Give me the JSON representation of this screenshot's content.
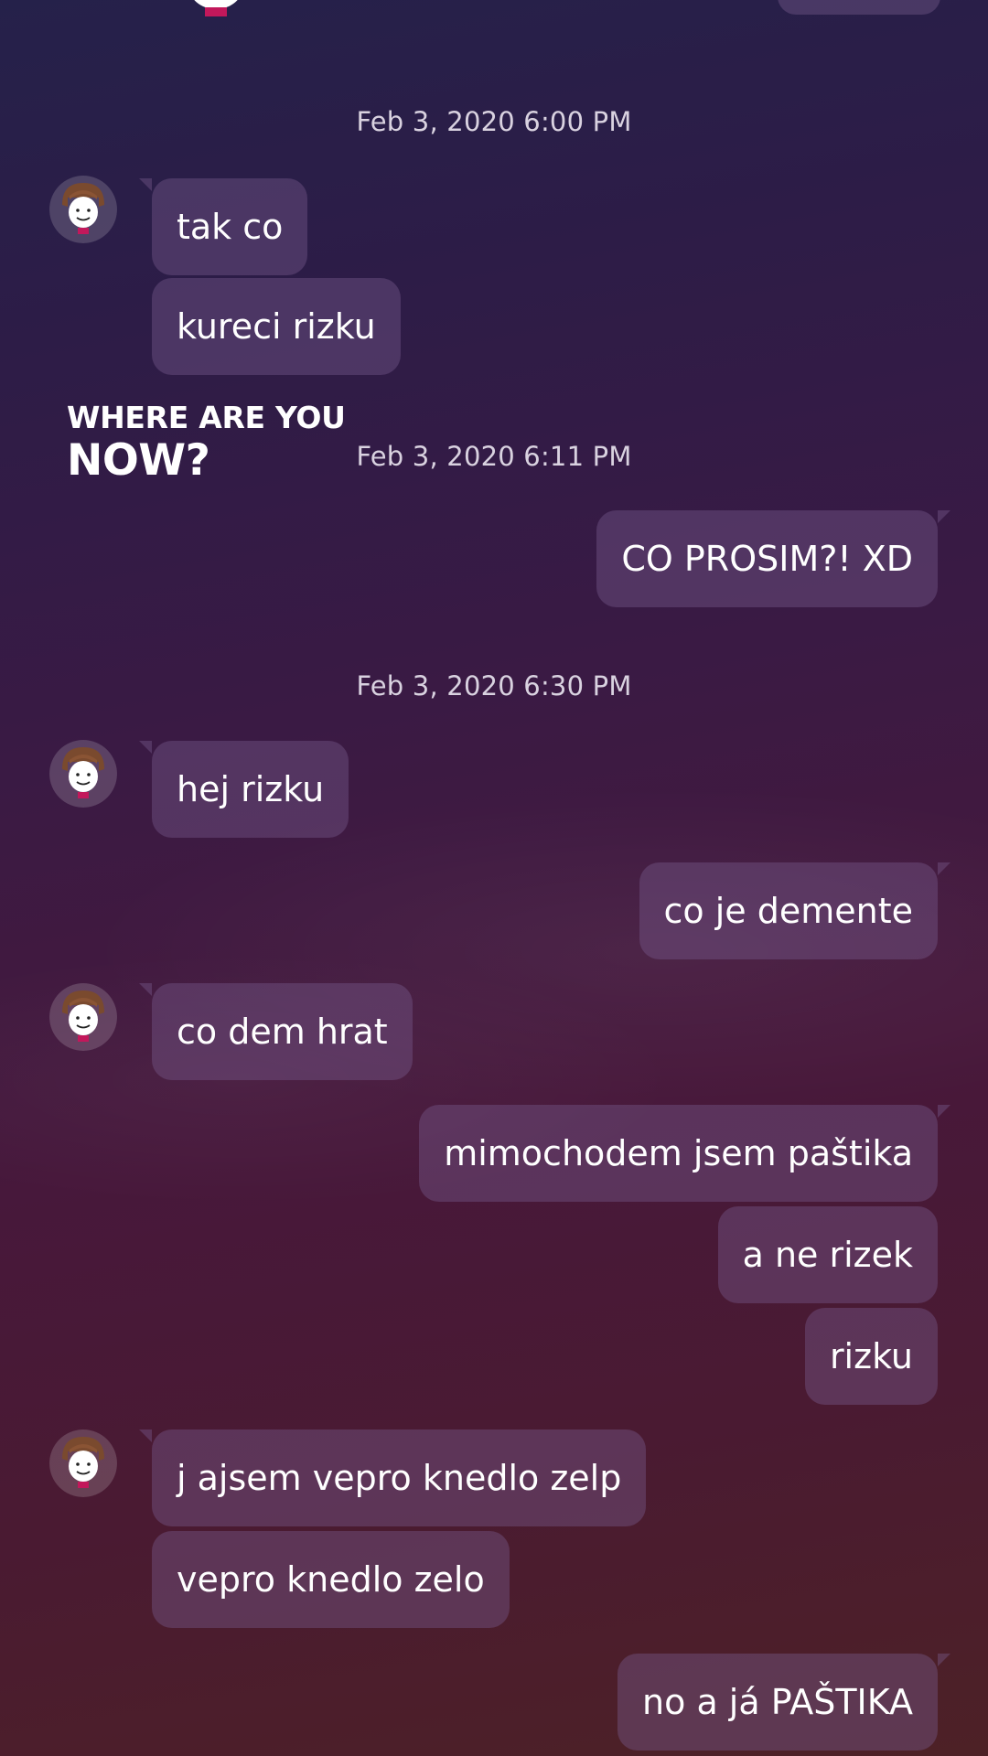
{
  "overlay": {
    "line1": "WHERE ARE YOU",
    "line2": "NOW?"
  },
  "timestamps": [
    "Feb 3, 2020 6:00 PM",
    "Feb 3, 2020 6:11 PM",
    "Feb 3, 2020 6:30 PM"
  ],
  "messages": [
    {
      "direction": "in",
      "text": "tak co"
    },
    {
      "direction": "in",
      "text": "kureci rizku"
    },
    {
      "direction": "out",
      "text": "CO PROSIM?! XD"
    },
    {
      "direction": "in",
      "text": "hej rizku"
    },
    {
      "direction": "out",
      "text": "co je demente"
    },
    {
      "direction": "in",
      "text": "co dem hrat"
    },
    {
      "direction": "out",
      "text": "mimochodem jsem paštika"
    },
    {
      "direction": "out",
      "text": "a ne rizek"
    },
    {
      "direction": "out",
      "text": "rizku"
    },
    {
      "direction": "in",
      "text": "j ajsem vepro knedlo zelp"
    },
    {
      "direction": "in",
      "text": "vepro knedlo zelo"
    },
    {
      "direction": "out",
      "text": "no a já PAŠTIKA"
    }
  ],
  "avatar_icon": "roblox-avatar-icon",
  "colors": {
    "bubble": "#6b4f7d",
    "timestamp_text": "#d9d2e0",
    "avatar_hair": "#7a4a2e",
    "avatar_collar": "#c2185b"
  }
}
